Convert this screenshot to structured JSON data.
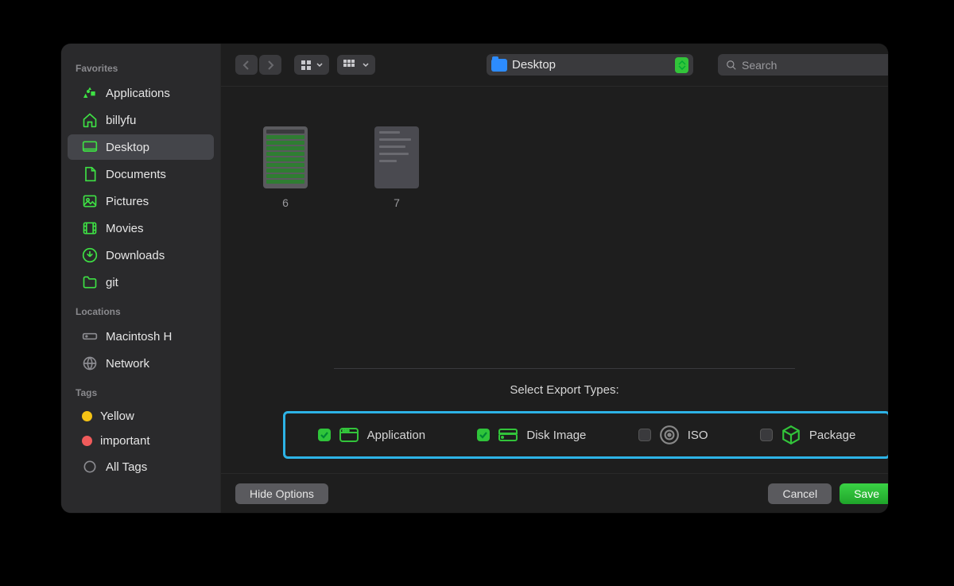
{
  "sidebar": {
    "sections": {
      "favorites": {
        "header": "Favorites"
      },
      "locations": {
        "header": "Locations"
      },
      "tags": {
        "header": "Tags"
      }
    },
    "favorites": [
      {
        "label": "Applications",
        "icon": "apps"
      },
      {
        "label": "billyfu",
        "icon": "home"
      },
      {
        "label": "Desktop",
        "icon": "desktop",
        "selected": true
      },
      {
        "label": "Documents",
        "icon": "doc"
      },
      {
        "label": "Pictures",
        "icon": "photo"
      },
      {
        "label": "Movies",
        "icon": "movie"
      },
      {
        "label": "Downloads",
        "icon": "download"
      },
      {
        "label": "git",
        "icon": "folder"
      }
    ],
    "locations": [
      {
        "label": "Macintosh H",
        "icon": "disk"
      },
      {
        "label": "Network",
        "icon": "globe"
      }
    ],
    "tags": [
      {
        "label": "Yellow",
        "color": "#f5c315"
      },
      {
        "label": "important",
        "color": "#f05b5b"
      },
      {
        "label": "All Tags",
        "icon": "alltags"
      }
    ]
  },
  "toolbar": {
    "path_label": "Desktop",
    "search_placeholder": "Search"
  },
  "files": [
    {
      "name": "6"
    },
    {
      "name": "7"
    }
  ],
  "export": {
    "title": "Select Export Types:",
    "options": [
      {
        "label": "Application",
        "checked": true,
        "icon": "app"
      },
      {
        "label": "Disk Image",
        "checked": true,
        "icon": "disk"
      },
      {
        "label": "ISO",
        "checked": false,
        "icon": "iso"
      },
      {
        "label": "Package",
        "checked": false,
        "icon": "pkg"
      }
    ]
  },
  "footer": {
    "hide_options": "Hide Options",
    "cancel": "Cancel",
    "save": "Save"
  },
  "colors": {
    "accent_green": "#32c43a",
    "highlight_blue": "#2db3e6"
  }
}
